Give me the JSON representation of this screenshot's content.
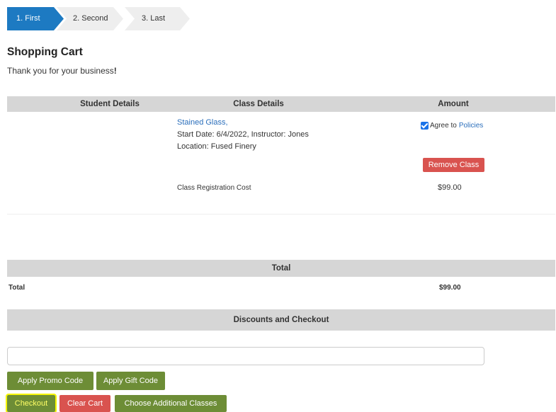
{
  "steps": [
    "1. First",
    "2. Second",
    "3. Last"
  ],
  "page": {
    "title": "Shopping Cart",
    "thank_you_prefix": "Thank you for your business",
    "thank_you_mark": "!"
  },
  "cart": {
    "headers": {
      "student": "Student Details",
      "class": "Class Details",
      "amount": "Amount"
    },
    "item": {
      "class_name": "Stained Glass,",
      "start_line": "Start Date: 6/4/2022, Instructor: Jones",
      "location_line": "Location: Fused Finery",
      "agree_label": "Agree to",
      "agree_checked": true,
      "policies_link": "Policies",
      "remove_label": "Remove Class",
      "cost_label": "Class Registration Cost",
      "cost_value": "$99.00"
    }
  },
  "totals": {
    "header": "Total",
    "label": "Total",
    "value": "$99.00"
  },
  "discounts": {
    "header": "Discounts and Checkout",
    "input_value": "",
    "input_placeholder": "",
    "promo_label": "Apply Promo Code",
    "gift_label": "Apply Gift Code",
    "checkout_label": "Checkout",
    "clear_label": "Clear Cart",
    "choose_label": "Choose Additional Classes"
  },
  "colors": {
    "primary": "#1d7ac2",
    "step_inactive": "#eeeeee",
    "band": "#d6d6d6",
    "link": "#2a6ebb",
    "danger": "#d9534f",
    "success": "#6d8d36",
    "highlight": "#f5f500"
  }
}
